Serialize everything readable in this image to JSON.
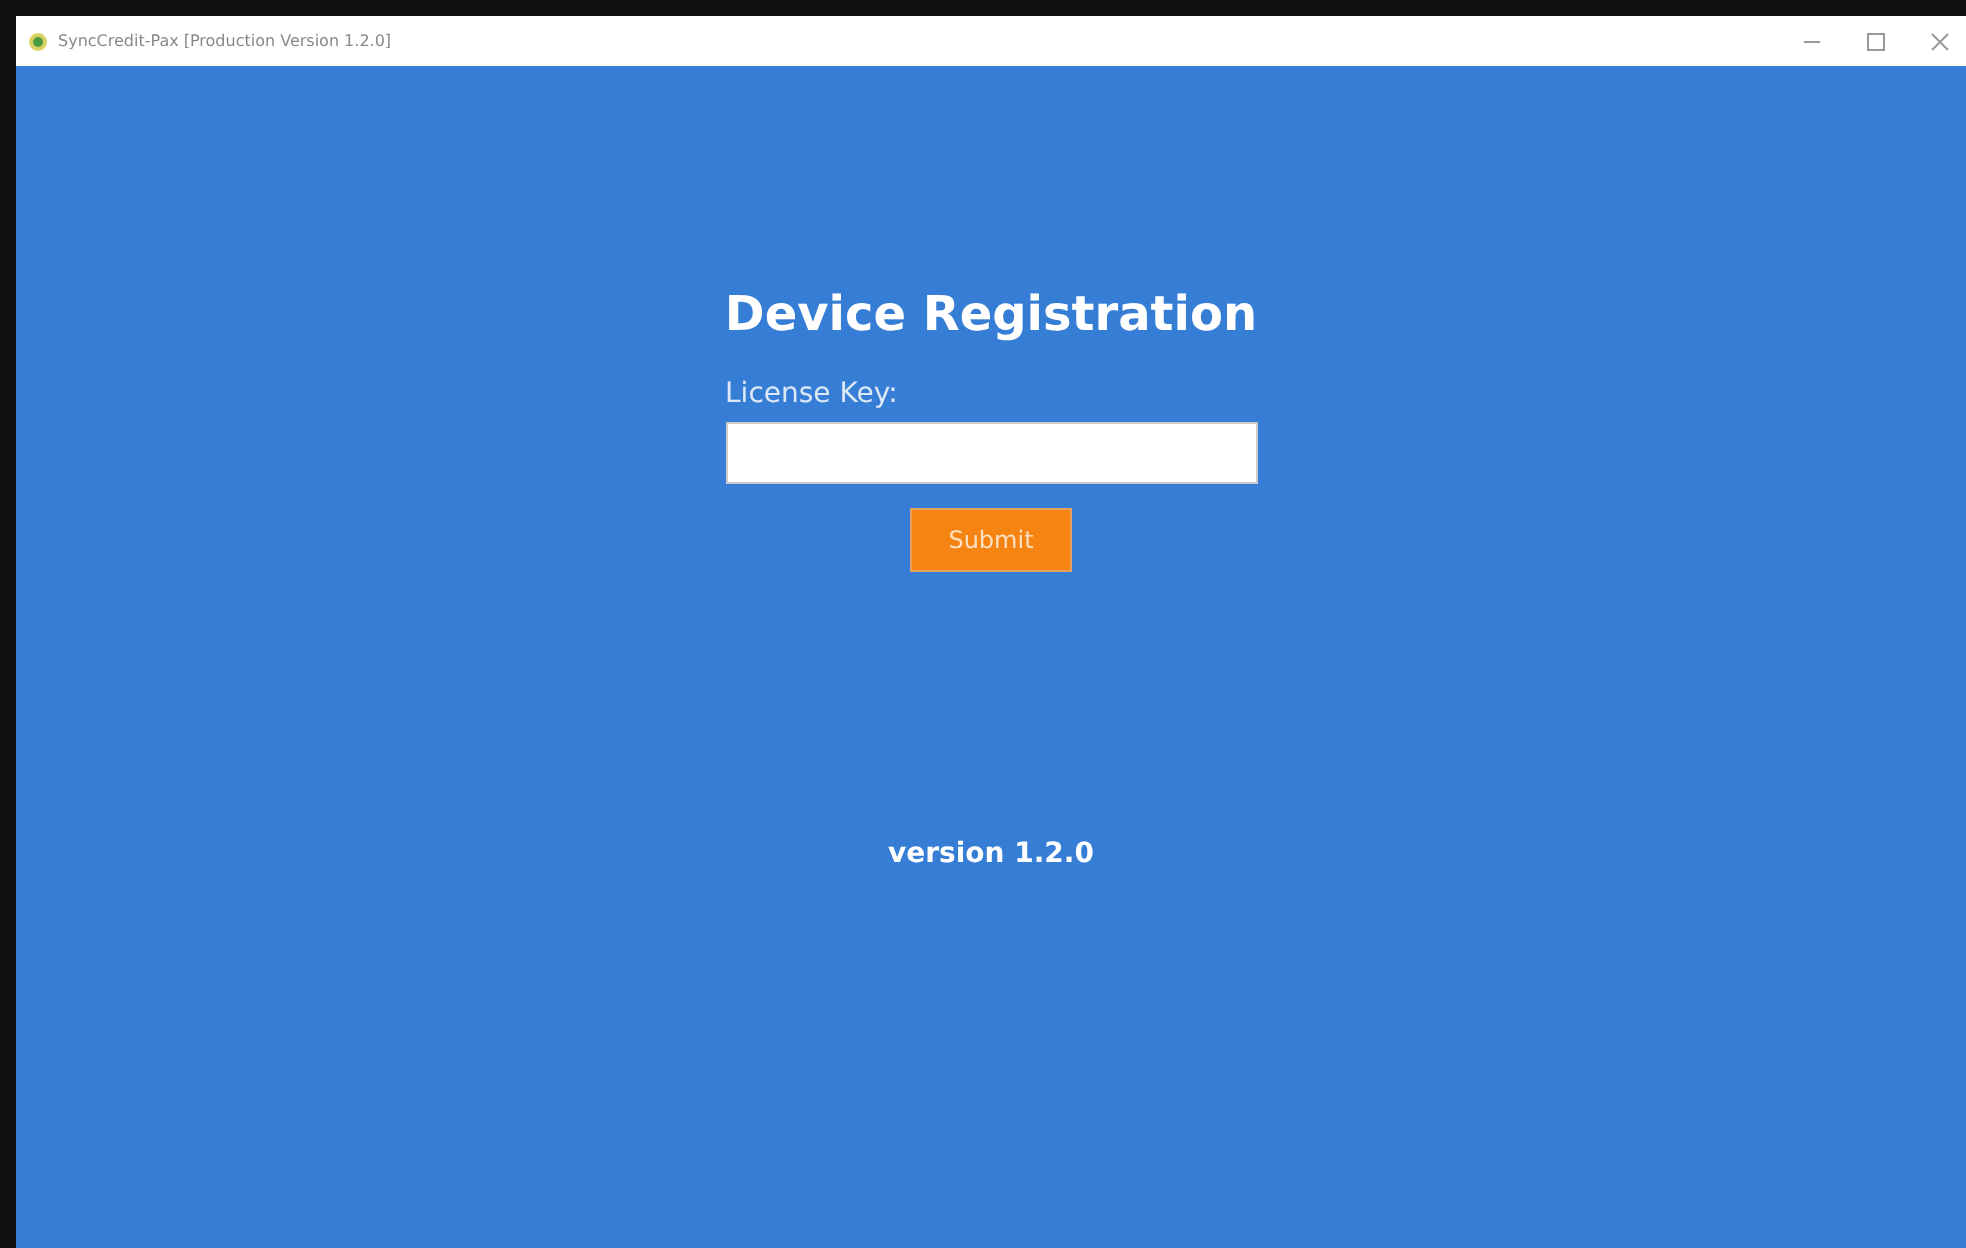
{
  "window": {
    "title": "SyncCredit-Pax [Production Version 1.2.0]"
  },
  "heading": "Device Registration",
  "license_field": {
    "label": "License Key:"
  },
  "submit_button": "Submit",
  "version": "version 1.2.0"
}
